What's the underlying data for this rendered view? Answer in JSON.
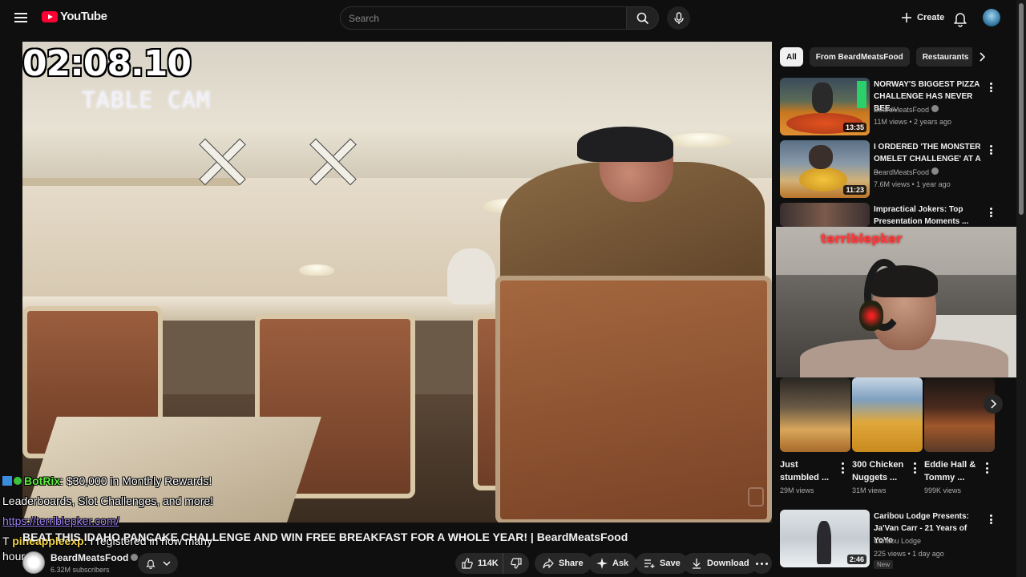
{
  "header": {
    "logo_text": "YouTube",
    "search_placeholder": "Search",
    "create_label": "Create",
    "icons": [
      "menu-icon",
      "search-icon",
      "mic-icon",
      "bell-icon"
    ]
  },
  "player": {
    "timer": "02:08.10",
    "cam_label": "TABLE CAM"
  },
  "chat": {
    "line1_user": "BotRix",
    "line1_text": ": $30,000 in Monthly Rewards!",
    "line2_text": "Leaderboards, Slot Challenges, and more!",
    "line3_link": "https://terriblepker.com/",
    "line4_prefix": "T",
    "line4_user": "pineappleexp",
    "line4_text": ": I registered in how many",
    "line5_text": "hours"
  },
  "video": {
    "title": "BEAT THIS IDAHO PANCAKE CHALLENGE AND WIN FREE BREAKFAST FOR A WHOLE YEAR! | BeardMeatsFood",
    "channel": "BeardMeatsFood",
    "subscribers": "6.32M subscribers",
    "likes": "114K",
    "share_label": "Share",
    "ask_label": "Ask",
    "save_label": "Save",
    "download_label": "Download"
  },
  "chips": [
    "All",
    "From BeardMeatsFood",
    "Restaurants"
  ],
  "recommendations": [
    {
      "title": "NORWAY'S BIGGEST PIZZA CHALLENGE HAS NEVER BEE...",
      "channel": "BeardMeatsFood",
      "meta": "11M views • 2 years ago",
      "duration": "13:35"
    },
    {
      "title": "I ORDERED 'THE MONSTER OMELET CHALLENGE' AT A ...",
      "channel": "BeardMeatsFood",
      "meta": "7.6M views • 1 year ago",
      "duration": "11:23"
    },
    {
      "title": "Impractical Jokers: Top Presentation Moments ...",
      "channel": "",
      "meta": "",
      "duration": ""
    }
  ],
  "webcam": {
    "handle": "terriblepker"
  },
  "shorts": [
    {
      "title": "Just stumbled ...",
      "views": "29M views"
    },
    {
      "title": "300 Chicken Nuggets ...",
      "views": "31M views"
    },
    {
      "title": "Eddie Hall & Tommy ...",
      "views": "999K views"
    }
  ],
  "bottom_rec": {
    "title": "Caribou Lodge Presents: Ja'Van Carr - 21 Years of YoYo",
    "channel": "Caribou Lodge",
    "meta": "225 views • 1 day ago",
    "duration": "2:46",
    "badge": "New"
  },
  "colors": {
    "brand": "#ff0033",
    "background": "#0f0f0f",
    "chip_bg": "#272727",
    "bot_name": "#5cf03c",
    "link": "#9b7ff0",
    "webcam_handle": "#ff3b3b"
  }
}
